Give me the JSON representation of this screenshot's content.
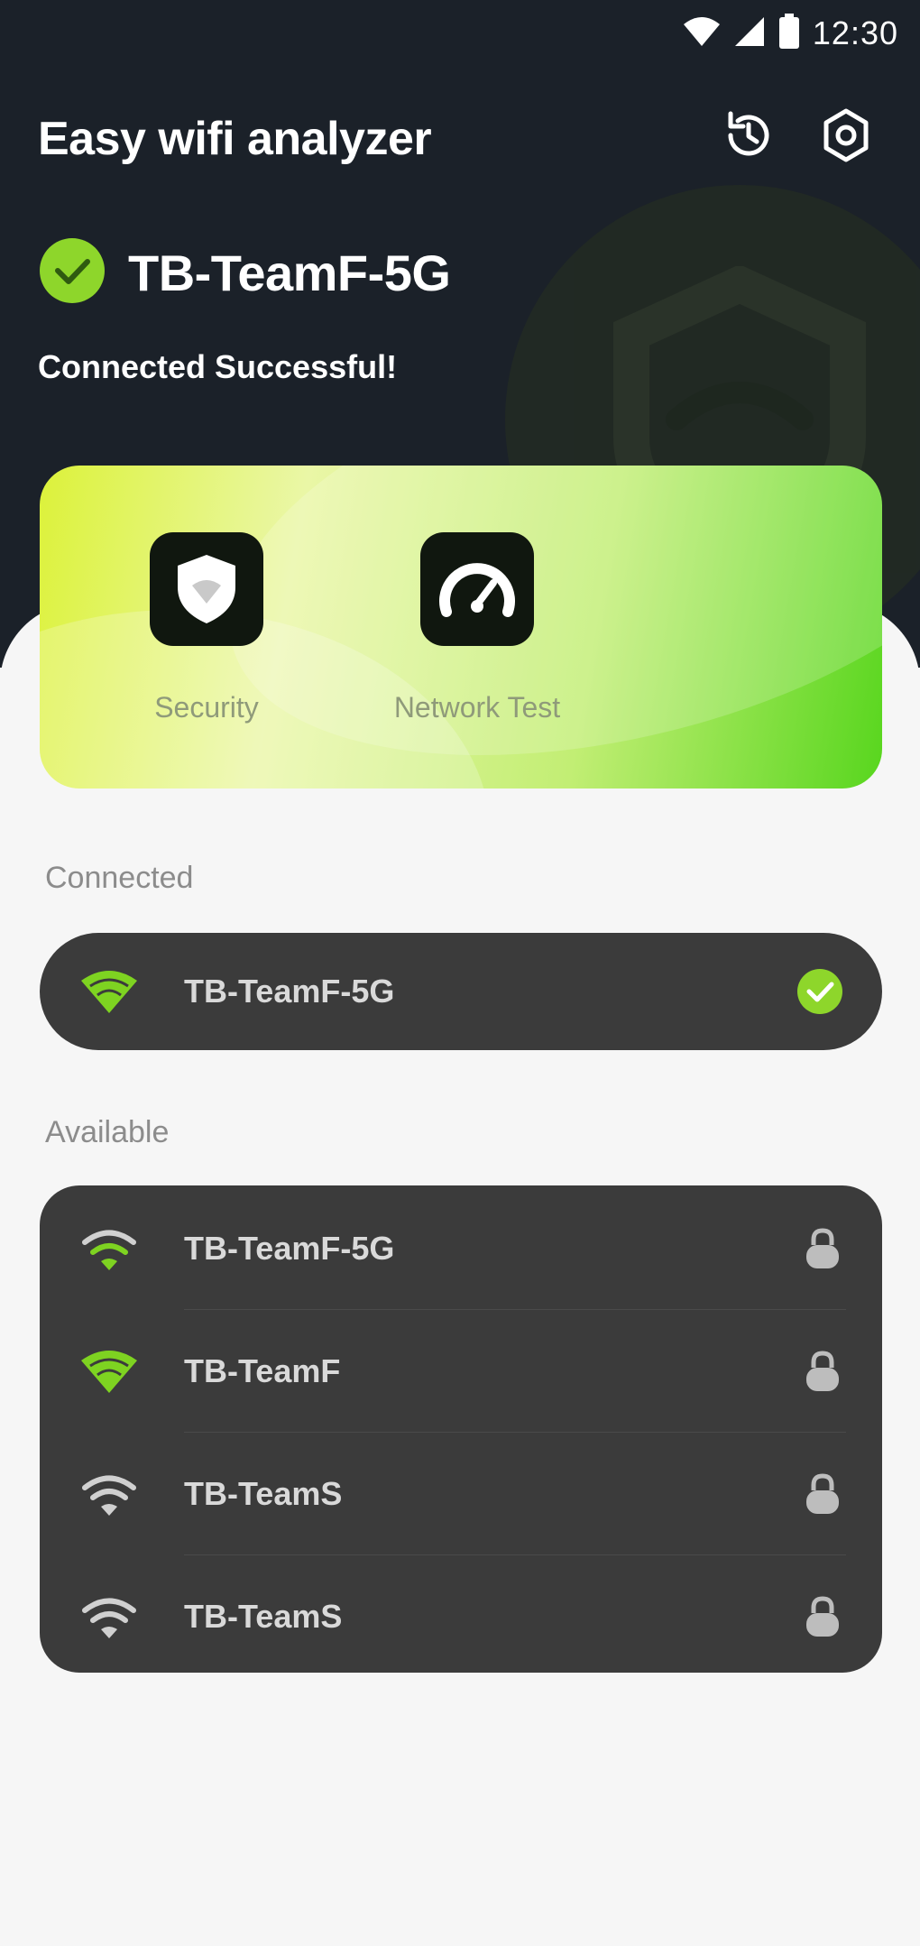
{
  "status_bar": {
    "time": "12:30",
    "icons": [
      "wifi-icon",
      "cell-signal-icon",
      "battery-icon"
    ]
  },
  "app_bar": {
    "title": "Easy wifi analyzer",
    "actions": [
      "history-icon",
      "settings-icon"
    ]
  },
  "connection": {
    "ssid": "TB-TeamF-5G",
    "status": "Connected Successful!"
  },
  "features": [
    {
      "label": "Security",
      "icon": "shield-wifi-icon"
    },
    {
      "label": "Network Test",
      "icon": "speedometer-icon"
    }
  ],
  "connected": {
    "section_label": "Connected",
    "network": {
      "ssid": "TB-TeamF-5G",
      "icon": "wifi-icon",
      "status_icon": "check-circle-icon"
    }
  },
  "available": {
    "section_label": "Available",
    "networks": [
      {
        "ssid": "TB-TeamF-5G",
        "icon": "wifi-icon",
        "lock_icon": "lock-icon"
      },
      {
        "ssid": "TB-TeamF",
        "icon": "wifi-icon",
        "lock_icon": "lock-icon"
      },
      {
        "ssid": "TB-TeamS",
        "icon": "wifi-icon",
        "lock_icon": "lock-icon"
      },
      {
        "ssid": "TB-TeamS",
        "icon": "wifi-icon",
        "lock_icon": "lock-icon"
      }
    ]
  },
  "colors": {
    "header_bg": "#1b2129",
    "accent_green": "#7ed321",
    "list_bg": "#3b3b3b",
    "page_bg": "#f6f6f6"
  }
}
